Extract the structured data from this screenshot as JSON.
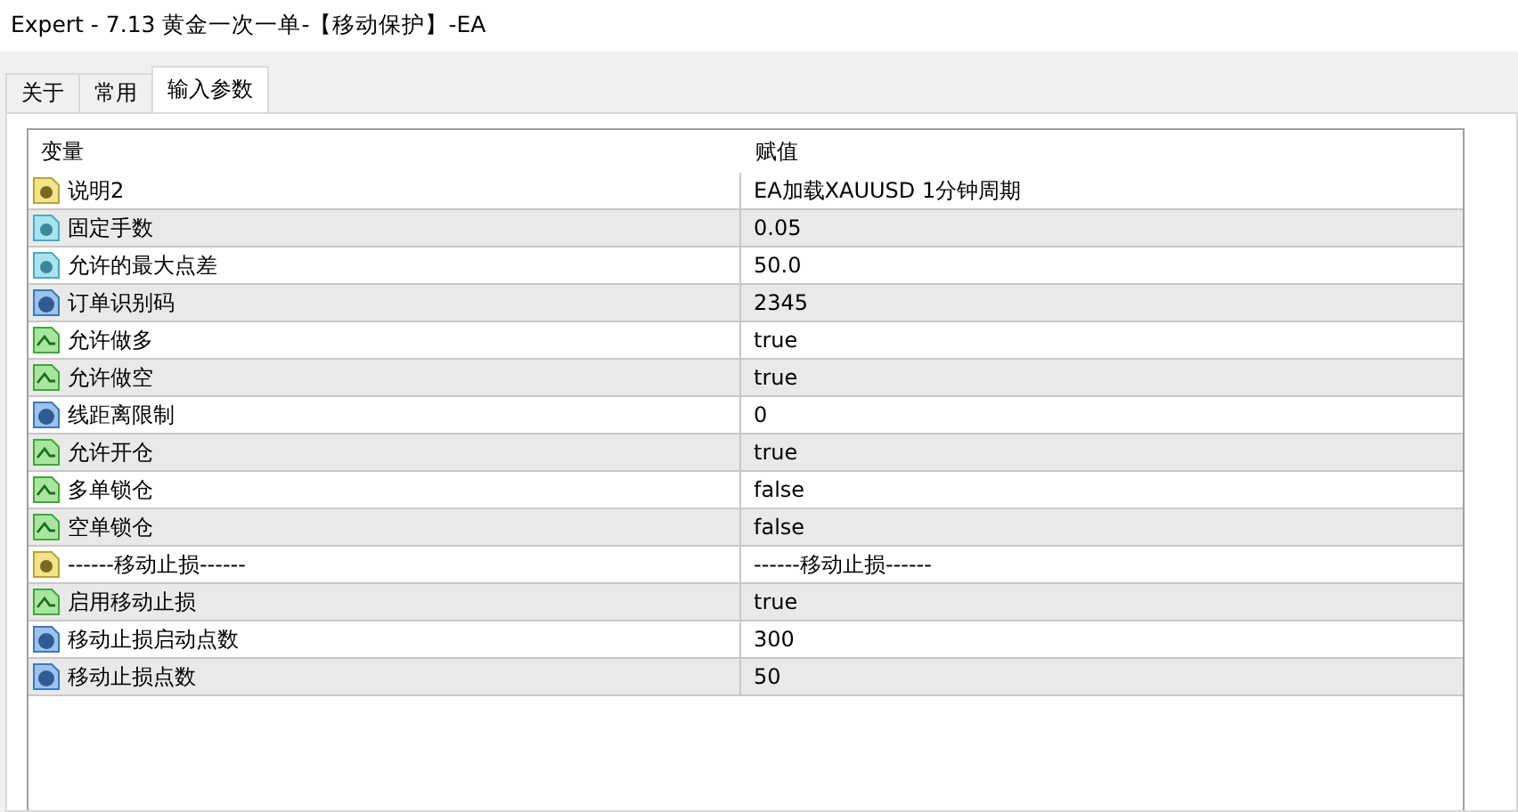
{
  "window": {
    "title": "Expert - 7.13 黄金一次一单-【移动保护】-EA"
  },
  "tabs": [
    {
      "label": "关于",
      "selected": false
    },
    {
      "label": "常用",
      "selected": false
    },
    {
      "label": "输入参数",
      "selected": true
    }
  ],
  "table": {
    "columns": [
      "变量",
      "赋值"
    ],
    "rows": [
      {
        "kind": "string",
        "name": "说明2",
        "value": "EA加载XAUUSD 1分钟周期"
      },
      {
        "kind": "double",
        "name": "固定手数",
        "value": "0.05"
      },
      {
        "kind": "double",
        "name": "允许的最大点差",
        "value": "50.0"
      },
      {
        "kind": "int",
        "name": "订单识别码",
        "value": "2345"
      },
      {
        "kind": "bool",
        "name": "允许做多",
        "value": "true"
      },
      {
        "kind": "bool",
        "name": "允许做空",
        "value": "true"
      },
      {
        "kind": "int",
        "name": "线距离限制",
        "value": "0"
      },
      {
        "kind": "bool",
        "name": "允许开仓",
        "value": "true"
      },
      {
        "kind": "bool",
        "name": "多单锁仓",
        "value": "false"
      },
      {
        "kind": "bool",
        "name": "空单锁仓",
        "value": "false"
      },
      {
        "kind": "string",
        "name": "------移动止损------",
        "value": "------移动止损------"
      },
      {
        "kind": "bool",
        "name": "启用移动止损",
        "value": "true"
      },
      {
        "kind": "int",
        "name": "移动止损启动点数",
        "value": "300"
      },
      {
        "kind": "int",
        "name": "移动止损点数",
        "value": "50"
      }
    ]
  }
}
